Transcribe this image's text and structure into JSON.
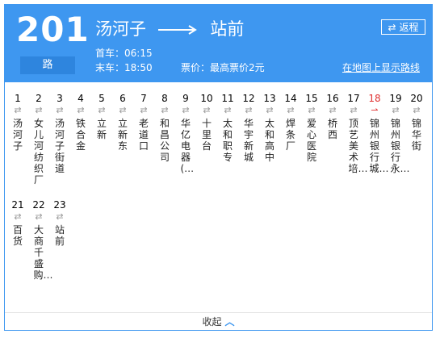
{
  "route": {
    "number": "201",
    "suffix": "路",
    "from": "汤河子",
    "to": "站前"
  },
  "times": {
    "first": "首车：06:15",
    "last": "末车：18:50"
  },
  "fare": "票价：最高票价2元",
  "map_link": "在地图上显示路线",
  "return_btn": "返程",
  "stops": [
    {
      "n": "1",
      "name": "汤河子"
    },
    {
      "n": "2",
      "name": "女儿河纺织厂"
    },
    {
      "n": "3",
      "name": "汤河子街道"
    },
    {
      "n": "4",
      "name": "铁合金"
    },
    {
      "n": "5",
      "name": "立新"
    },
    {
      "n": "6",
      "name": "立新东"
    },
    {
      "n": "7",
      "name": "老道口"
    },
    {
      "n": "8",
      "name": "和昌公司"
    },
    {
      "n": "9",
      "name": "华亿电器(…"
    },
    {
      "n": "10",
      "name": "十里台"
    },
    {
      "n": "11",
      "name": "太和职专"
    },
    {
      "n": "12",
      "name": "华宇新城"
    },
    {
      "n": "13",
      "name": "太和高中"
    },
    {
      "n": "14",
      "name": "焊条厂"
    },
    {
      "n": "15",
      "name": "爱心医院"
    },
    {
      "n": "16",
      "name": "桥西"
    },
    {
      "n": "17",
      "name": "顶艺美术培…"
    },
    {
      "n": "18",
      "name": "锦州银行城…"
    },
    {
      "n": "19",
      "name": "锦州银行永…"
    },
    {
      "n": "20",
      "name": "锦华街"
    },
    {
      "n": "21",
      "name": "百货"
    },
    {
      "n": "22",
      "name": "大商千盛购…"
    },
    {
      "n": "23",
      "name": "站前"
    }
  ],
  "current_stop": "18",
  "collapse_label": "收起",
  "colors": {
    "header": "#3e97f0",
    "current": "#e03131"
  }
}
